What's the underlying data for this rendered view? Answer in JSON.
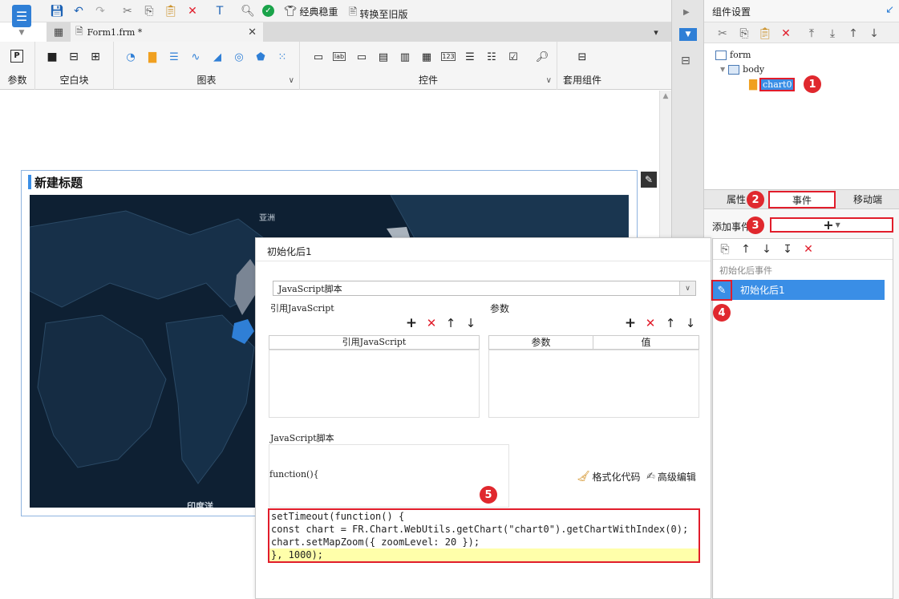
{
  "toolbar": {
    "classic_label": "经典稳重",
    "convert_label": "转换至旧版"
  },
  "tab": {
    "title": "Form1.frm *"
  },
  "ribbon": {
    "groups": [
      {
        "label": "参数"
      },
      {
        "label": "空白块"
      },
      {
        "label": "图表"
      },
      {
        "label": "控件"
      },
      {
        "label": "套用组件"
      }
    ]
  },
  "canvas": {
    "widget_title": "新建标题",
    "map_labels": [
      "亚洲",
      "印度洋"
    ]
  },
  "right_panel": {
    "title": "组件设置",
    "tree": [
      "form",
      "body",
      "chart0"
    ],
    "tabs": [
      "属性",
      "事件",
      "移动端"
    ],
    "add_event_label": "添加事件",
    "add_event_symbol": "+",
    "event_group": "初始化后事件",
    "event_item": "初始化后1"
  },
  "dialog": {
    "title": "初始化后1",
    "select_value": "JavaScript脚本",
    "ref_js_section": "引用JavaScript",
    "params_section": "参数",
    "ref_js_column": "引用JavaScript",
    "param_columns": [
      "参数",
      "值"
    ],
    "js_section": "JavaScript脚本",
    "function_header": "function(){",
    "format_code_label": "格式化代码",
    "advanced_edit_label": "高级编辑",
    "code_lines": [
      "setTimeout(function() {",
      "const chart = FR.Chart.WebUtils.getChart(\"chart0\").getChartWithIndex(0);",
      "chart.setMapZoom({ zoomLevel: 20 });",
      "}, 1000);"
    ]
  },
  "badges": [
    "1",
    "2",
    "3",
    "4",
    "5"
  ],
  "colors": {
    "accent": "#2f7fd6",
    "highlight_red": "#e11d2b",
    "selected_blue": "#3a8ee6",
    "map_bg": "#0e2033"
  }
}
